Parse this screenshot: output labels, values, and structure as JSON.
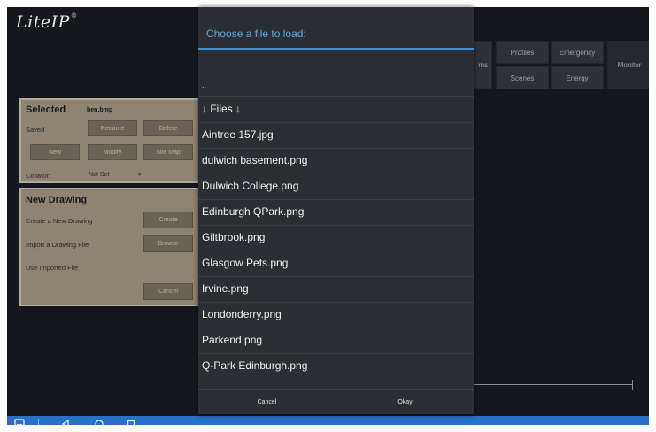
{
  "app": {
    "logo": "LiteIP",
    "logo_mark": "®"
  },
  "topbar": {
    "partial_label": "ms",
    "buttons": [
      "Profiles",
      "Emergency",
      "Scenes",
      "Energy"
    ],
    "monitor": "Monitor"
  },
  "selected_panel": {
    "title": "Selected",
    "filename": "ben.bmp",
    "saved_label": "Saved",
    "rename": "Rename",
    "delete": "Delete",
    "new": "New",
    "modify": "Modify",
    "sitemap": "Site Map",
    "collator_label": "Collator:",
    "collator_value": "Not Set",
    "collator_arrow": "▾"
  },
  "new_drawing_panel": {
    "title": "New Drawing",
    "create_label": "Create a New Drawing",
    "create_button": "Create",
    "import_label": "Import a Drawing File",
    "browse_button": "Browse",
    "use_label": "Use Imported File",
    "cancel_button": "Cancel"
  },
  "dialog": {
    "title": "Choose a file to load:",
    "parent": "..",
    "files_header": "↓ Files ↓",
    "files": [
      "Aintree 157.jpg",
      "dulwich basement.png",
      "Dulwich College.png",
      "Edinburgh QPark.png",
      "Giltbrook.png",
      "Glasgow Pets.png",
      "Irvine.png",
      "Londonderry.png",
      "Parkend.png",
      "Q-Park Edinburgh.png"
    ],
    "cancel": "Cancel",
    "okay": "Okay"
  },
  "navbar": {
    "icons": [
      "app-icon",
      "back-icon",
      "home-icon",
      "recents-icon"
    ]
  },
  "colors": {
    "accent": "#3f8fd0",
    "navbar": "#2a6fc9",
    "panel": "#8f8473",
    "dialog": "#2b2e32",
    "background": "#14171b"
  }
}
